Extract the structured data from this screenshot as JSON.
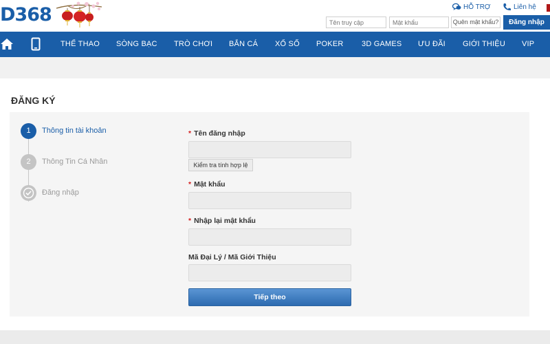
{
  "brand": {
    "logo_text": "D368",
    "primary_color": "#1a5ea8",
    "required_color": "#d42020"
  },
  "header": {
    "support_label": "HỖ TRỢ",
    "support_icon": "chat-bubbles-icon",
    "contact_label": "Liên hệ",
    "contact_icon": "phone-icon",
    "username_placeholder": "Tên truy cập",
    "password_placeholder": "Mật khẩu",
    "forgot_label": "Quên mật khẩu?",
    "login_label": "Đăng nhập"
  },
  "nav": {
    "home_icon": "home-icon",
    "mobile_icon": "mobile-phone-icon",
    "items": [
      "THỂ THAO",
      "SÒNG BẠC",
      "TRÒ CHƠI",
      "BẮN CÁ",
      "XỔ SỐ",
      "POKER",
      "3D GAMES",
      "ƯU ĐÃI",
      "GIỚI THIỆU",
      "VIP"
    ]
  },
  "page": {
    "title": "ĐĂNG KÝ"
  },
  "steps": [
    {
      "number": "1",
      "label": "Thông tin tài khoản",
      "state": "active"
    },
    {
      "number": "2",
      "label": "Thông Tin Cá Nhân",
      "state": "inactive"
    },
    {
      "number": "",
      "label": "Đăng nhập",
      "state": "inactive",
      "icon": "check-icon"
    }
  ],
  "form": {
    "required_mark": "*",
    "username_label": "Tên đăng nhập",
    "username_value": "",
    "check_label": "Kiểm tra tính hợp lệ",
    "password_label": "Mật khẩu",
    "password_value": "",
    "confirm_label": "Nhập lại mật khẩu",
    "confirm_value": "",
    "agent_label": "Mã Đại Lý / Mã Giới Thiệu",
    "agent_value": "",
    "next_label": "Tiếp theo"
  }
}
